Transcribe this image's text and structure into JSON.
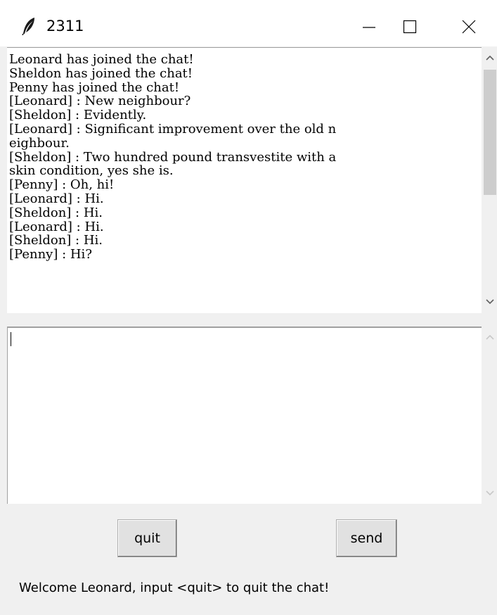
{
  "window": {
    "title": "2311",
    "icon": "feather-icon",
    "controls": {
      "minimize_icon": "minimize-icon",
      "maximize_icon": "maximize-icon",
      "close_icon": "close-icon"
    }
  },
  "chat_log": {
    "lines": [
      "Leonard has joined the chat!",
      "Sheldon has joined the chat!",
      "Penny has joined the chat!",
      "[Leonard] : New neighbour?",
      "[Sheldon] : Evidently.",
      "[Leonard] : Significant improvement over the old n",
      "eighbour.",
      "[Sheldon] : Two hundred pound transvestite with a",
      "skin condition, yes she is.",
      "[Penny] : Oh, hi!",
      "[Leonard] : Hi.",
      "[Sheldon] : Hi.",
      "[Leonard] : Hi.",
      "[Sheldon] : Hi.",
      "[Penny] : Hi?"
    ]
  },
  "input": {
    "value": ""
  },
  "buttons": {
    "quit_label": "quit",
    "send_label": "send"
  },
  "status": {
    "text": "Welcome Leonard, input <quit> to quit the chat!"
  },
  "colors": {
    "titlebar": "#ffffff",
    "window_bg": "#f0f0f0",
    "button_bg": "#e1e1e1",
    "scroll_thumb": "#cdcdcd"
  }
}
